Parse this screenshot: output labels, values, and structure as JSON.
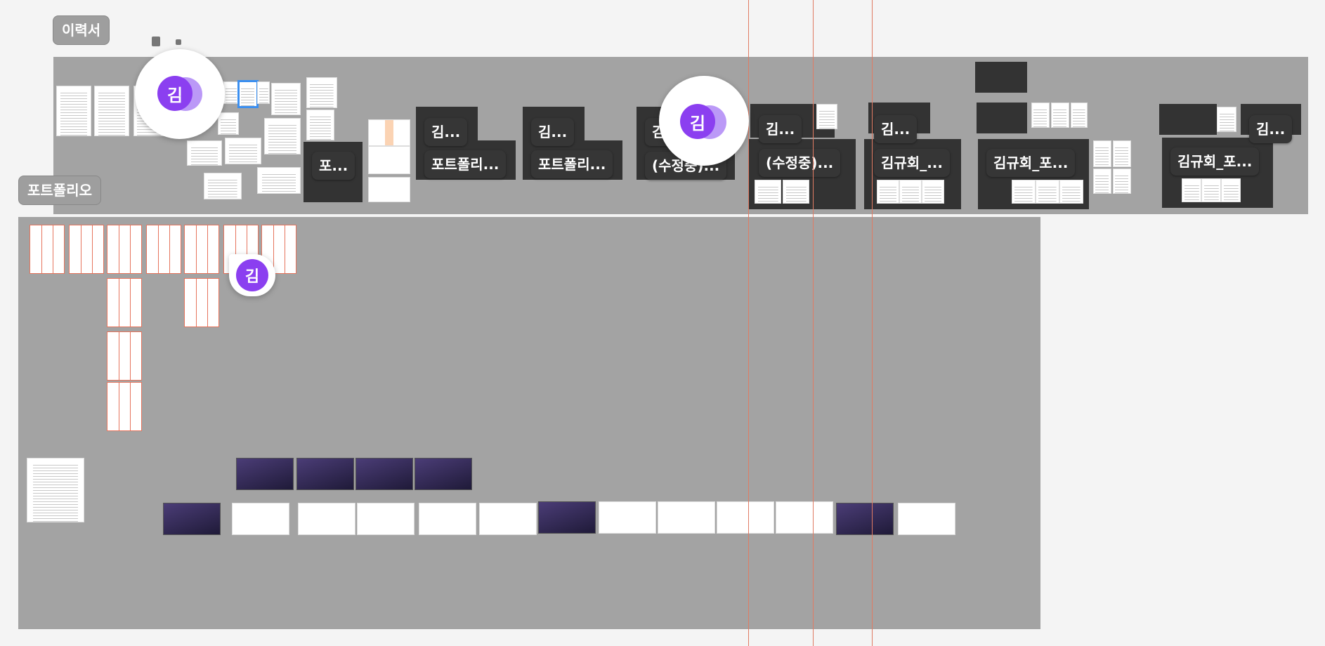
{
  "canvas": {
    "sections": {
      "resume": {
        "label": "이력서"
      },
      "portfolio": {
        "label": "포트폴리오"
      }
    },
    "frame_labels": [
      "포...",
      "김...",
      "포트폴리...",
      "김...",
      "포트폴리...",
      "김...",
      "(수정중)...",
      "김...",
      "(수정중)...",
      "김...",
      "김규회_...",
      "김규회_포...",
      "김...",
      "김규회_포..."
    ],
    "cursors": [
      {
        "initial": "김"
      },
      {
        "initial": "김"
      },
      {
        "initial": "김"
      }
    ],
    "colors": {
      "canvas_bg": "#f4f4f4",
      "section_bg": "#a3a3a3",
      "avatar_purple": "#8b3ff0",
      "guide_red": "#e07b63",
      "label_dark": "#363636"
    }
  }
}
